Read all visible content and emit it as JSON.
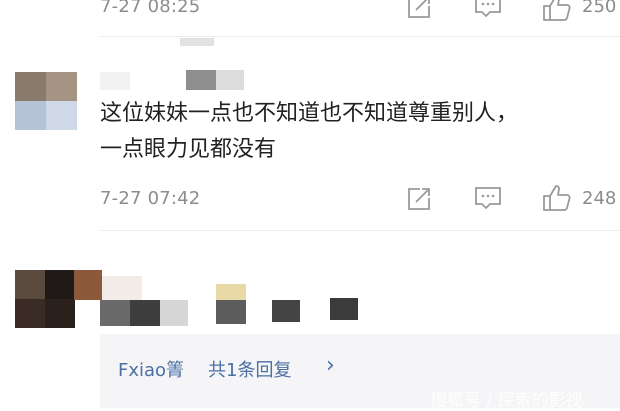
{
  "comments": [
    {
      "time": "7-27 08:25",
      "like_count": "250",
      "actions": [
        "share-icon",
        "comment-icon",
        "like-icon"
      ]
    },
    {
      "text_line1": "这位妹妹一点也不知道也不知道尊重别人，",
      "text_line2": "一点眼力见都没有",
      "time": "7-27 07:42",
      "like_count": "248",
      "actions": [
        "share-icon",
        "comment-icon",
        "like-icon"
      ]
    }
  ],
  "reply_summary": {
    "author": "Fxiao箐",
    "label": "共1条回复",
    "chevron": "›"
  },
  "watermark": "搜狐号 / 探索的影视",
  "colors": {
    "link": "#4a6fa5",
    "meta": "#8c8c8c",
    "reply_bg": "#f5f5f7"
  }
}
